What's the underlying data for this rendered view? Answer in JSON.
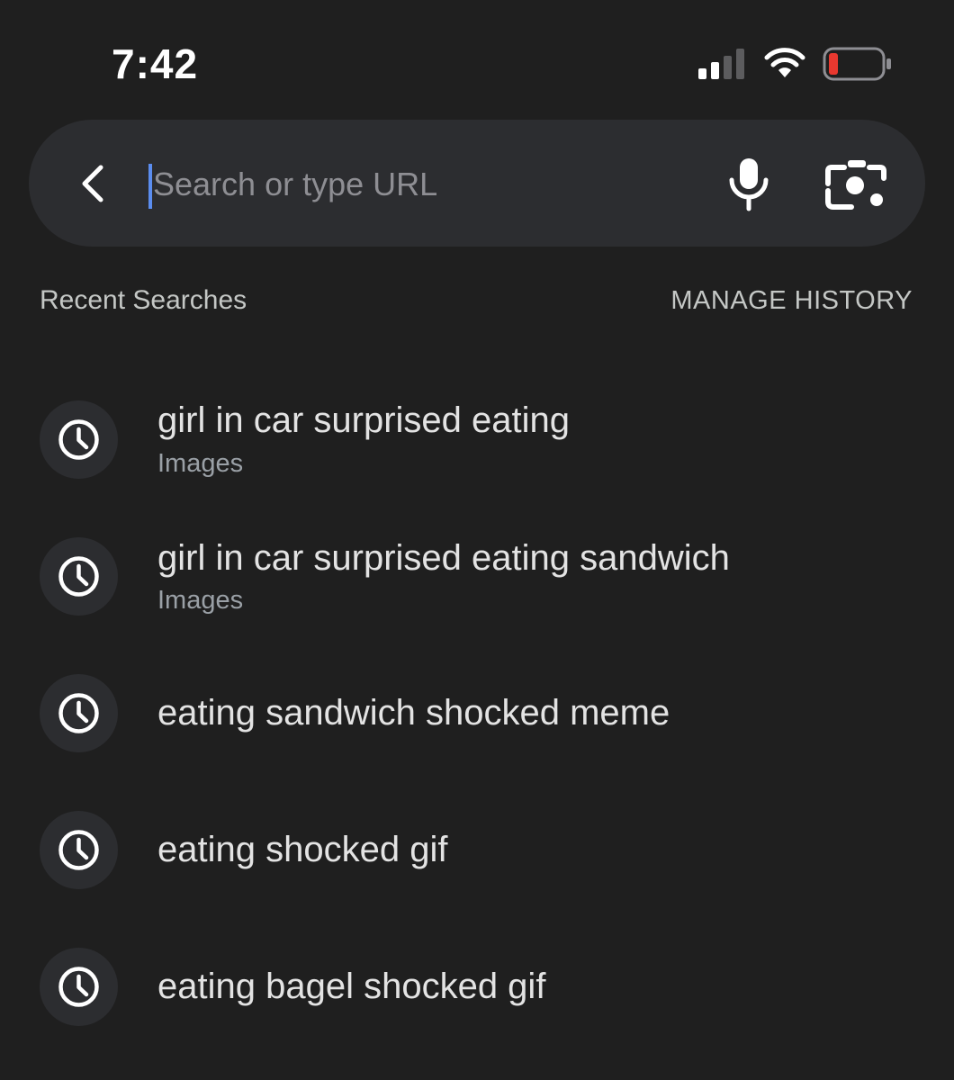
{
  "status_bar": {
    "time": "7:42",
    "battery_level_color": "#e8382f"
  },
  "search": {
    "placeholder": "Search or type URL",
    "value": ""
  },
  "recent": {
    "title": "Recent Searches",
    "manage_label": "MANAGE HISTORY"
  },
  "history": [
    {
      "title": "girl in car surprised eating",
      "subtitle": "Images",
      "icon": "clock-icon"
    },
    {
      "title": "girl in car surprised eating sandwich",
      "subtitle": "Images",
      "icon": "clock-icon"
    },
    {
      "title": "eating sandwich shocked meme",
      "subtitle": "",
      "icon": "clock-icon"
    },
    {
      "title": "eating shocked gif",
      "subtitle": "",
      "icon": "clock-icon"
    },
    {
      "title": "eating bagel shocked gif",
      "subtitle": "",
      "icon": "clock-icon"
    }
  ],
  "colors": {
    "background": "#1f1f1f",
    "search_bar": "#2c2d30",
    "caret": "#5b8def"
  }
}
